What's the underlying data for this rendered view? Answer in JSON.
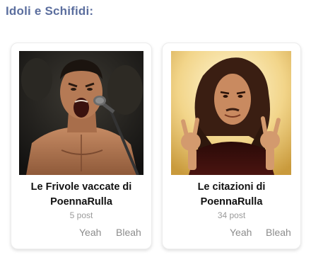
{
  "section": {
    "title": "Idoli e Schifidi:"
  },
  "cards": [
    {
      "title_line1": "Le Frivole vaccate di",
      "title_line2": "PoennaRulla",
      "post_count": "5 post",
      "yeah_label": "Yeah",
      "bleah_label": "Bleah",
      "image": "shouting-man-microphone"
    },
    {
      "title_line1": "Le citazioni di",
      "title_line2": "PoennaRulla",
      "post_count": "34 post",
      "yeah_label": "Yeah",
      "bleah_label": "Bleah",
      "image": "metal-horns-man"
    }
  ],
  "colors": {
    "title": "#5b6e9e",
    "card_text": "#111111",
    "meta_text": "#9a9a9a",
    "vote_text": "#8c8c8c"
  }
}
